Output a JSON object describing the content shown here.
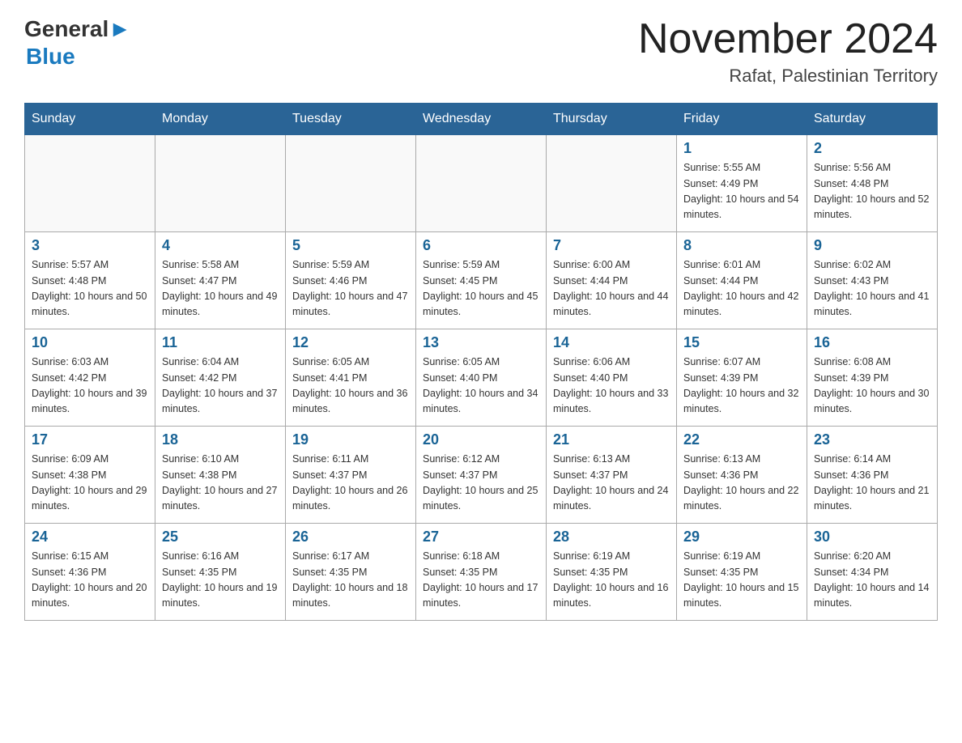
{
  "header": {
    "logo_general": "General",
    "logo_blue": "Blue",
    "month_title": "November 2024",
    "location": "Rafat, Palestinian Territory"
  },
  "days_of_week": [
    "Sunday",
    "Monday",
    "Tuesday",
    "Wednesday",
    "Thursday",
    "Friday",
    "Saturday"
  ],
  "weeks": [
    [
      {
        "day": "",
        "info": ""
      },
      {
        "day": "",
        "info": ""
      },
      {
        "day": "",
        "info": ""
      },
      {
        "day": "",
        "info": ""
      },
      {
        "day": "",
        "info": ""
      },
      {
        "day": "1",
        "info": "Sunrise: 5:55 AM\nSunset: 4:49 PM\nDaylight: 10 hours and 54 minutes."
      },
      {
        "day": "2",
        "info": "Sunrise: 5:56 AM\nSunset: 4:48 PM\nDaylight: 10 hours and 52 minutes."
      }
    ],
    [
      {
        "day": "3",
        "info": "Sunrise: 5:57 AM\nSunset: 4:48 PM\nDaylight: 10 hours and 50 minutes."
      },
      {
        "day": "4",
        "info": "Sunrise: 5:58 AM\nSunset: 4:47 PM\nDaylight: 10 hours and 49 minutes."
      },
      {
        "day": "5",
        "info": "Sunrise: 5:59 AM\nSunset: 4:46 PM\nDaylight: 10 hours and 47 minutes."
      },
      {
        "day": "6",
        "info": "Sunrise: 5:59 AM\nSunset: 4:45 PM\nDaylight: 10 hours and 45 minutes."
      },
      {
        "day": "7",
        "info": "Sunrise: 6:00 AM\nSunset: 4:44 PM\nDaylight: 10 hours and 44 minutes."
      },
      {
        "day": "8",
        "info": "Sunrise: 6:01 AM\nSunset: 4:44 PM\nDaylight: 10 hours and 42 minutes."
      },
      {
        "day": "9",
        "info": "Sunrise: 6:02 AM\nSunset: 4:43 PM\nDaylight: 10 hours and 41 minutes."
      }
    ],
    [
      {
        "day": "10",
        "info": "Sunrise: 6:03 AM\nSunset: 4:42 PM\nDaylight: 10 hours and 39 minutes."
      },
      {
        "day": "11",
        "info": "Sunrise: 6:04 AM\nSunset: 4:42 PM\nDaylight: 10 hours and 37 minutes."
      },
      {
        "day": "12",
        "info": "Sunrise: 6:05 AM\nSunset: 4:41 PM\nDaylight: 10 hours and 36 minutes."
      },
      {
        "day": "13",
        "info": "Sunrise: 6:05 AM\nSunset: 4:40 PM\nDaylight: 10 hours and 34 minutes."
      },
      {
        "day": "14",
        "info": "Sunrise: 6:06 AM\nSunset: 4:40 PM\nDaylight: 10 hours and 33 minutes."
      },
      {
        "day": "15",
        "info": "Sunrise: 6:07 AM\nSunset: 4:39 PM\nDaylight: 10 hours and 32 minutes."
      },
      {
        "day": "16",
        "info": "Sunrise: 6:08 AM\nSunset: 4:39 PM\nDaylight: 10 hours and 30 minutes."
      }
    ],
    [
      {
        "day": "17",
        "info": "Sunrise: 6:09 AM\nSunset: 4:38 PM\nDaylight: 10 hours and 29 minutes."
      },
      {
        "day": "18",
        "info": "Sunrise: 6:10 AM\nSunset: 4:38 PM\nDaylight: 10 hours and 27 minutes."
      },
      {
        "day": "19",
        "info": "Sunrise: 6:11 AM\nSunset: 4:37 PM\nDaylight: 10 hours and 26 minutes."
      },
      {
        "day": "20",
        "info": "Sunrise: 6:12 AM\nSunset: 4:37 PM\nDaylight: 10 hours and 25 minutes."
      },
      {
        "day": "21",
        "info": "Sunrise: 6:13 AM\nSunset: 4:37 PM\nDaylight: 10 hours and 24 minutes."
      },
      {
        "day": "22",
        "info": "Sunrise: 6:13 AM\nSunset: 4:36 PM\nDaylight: 10 hours and 22 minutes."
      },
      {
        "day": "23",
        "info": "Sunrise: 6:14 AM\nSunset: 4:36 PM\nDaylight: 10 hours and 21 minutes."
      }
    ],
    [
      {
        "day": "24",
        "info": "Sunrise: 6:15 AM\nSunset: 4:36 PM\nDaylight: 10 hours and 20 minutes."
      },
      {
        "day": "25",
        "info": "Sunrise: 6:16 AM\nSunset: 4:35 PM\nDaylight: 10 hours and 19 minutes."
      },
      {
        "day": "26",
        "info": "Sunrise: 6:17 AM\nSunset: 4:35 PM\nDaylight: 10 hours and 18 minutes."
      },
      {
        "day": "27",
        "info": "Sunrise: 6:18 AM\nSunset: 4:35 PM\nDaylight: 10 hours and 17 minutes."
      },
      {
        "day": "28",
        "info": "Sunrise: 6:19 AM\nSunset: 4:35 PM\nDaylight: 10 hours and 16 minutes."
      },
      {
        "day": "29",
        "info": "Sunrise: 6:19 AM\nSunset: 4:35 PM\nDaylight: 10 hours and 15 minutes."
      },
      {
        "day": "30",
        "info": "Sunrise: 6:20 AM\nSunset: 4:34 PM\nDaylight: 10 hours and 14 minutes."
      }
    ]
  ]
}
